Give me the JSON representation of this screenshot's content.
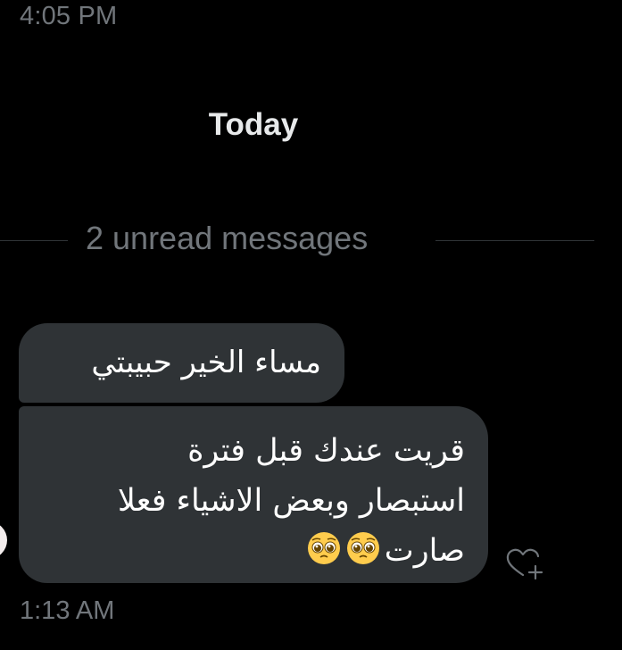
{
  "thread": {
    "previous_timestamp": "4:05 PM",
    "day_label": "Today",
    "unread_label": "2 unread messages"
  },
  "messages": [
    {
      "text": "مساء الخير حبيبتي"
    },
    {
      "lines": [
        "قريت عندك قبل فترة",
        "استبصار وبعض الاشياء فعلا",
        "صارت"
      ],
      "emojis": [
        "pleading-face",
        "pleading-face"
      ],
      "timestamp": "1:13 AM"
    }
  ],
  "icons": {
    "reaction": "heart-plus-icon",
    "emoji": "pleading-face-emoji"
  },
  "colors": {
    "background": "#000000",
    "bubble": "#2f3336",
    "muted_text": "#71767b",
    "primary_text": "#e7e9ea",
    "message_text": "#ffffff"
  }
}
